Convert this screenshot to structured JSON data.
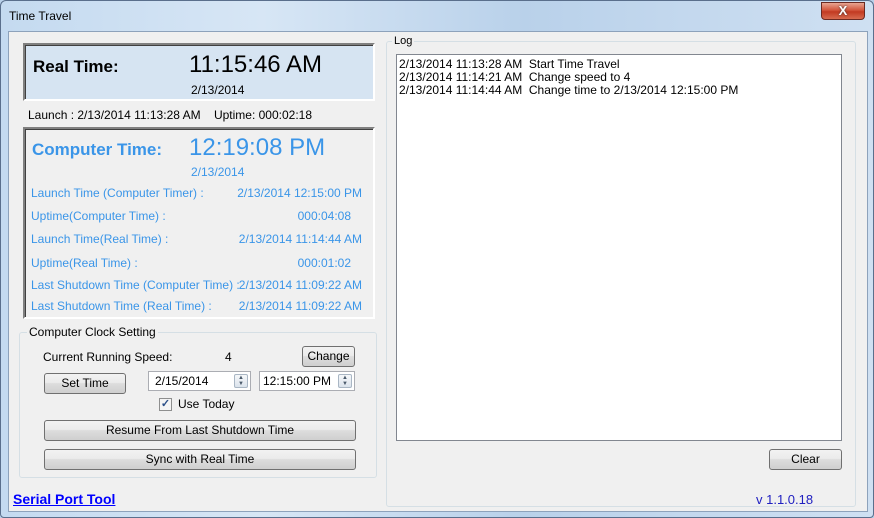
{
  "window": {
    "title": "Time Travel",
    "close_glyph": "X"
  },
  "real_time": {
    "label": "Real Time:",
    "time": "11:15:46 AM",
    "date": "2/13/2014",
    "launch": "Launch : 2/13/2014 11:13:28 AM",
    "uptime": "Uptime: 000:02:18"
  },
  "computer_time": {
    "label": "Computer Time:",
    "time": "12:19:08 PM",
    "date": "2/13/2014",
    "color": "#3a95e8",
    "rows": [
      {
        "key": "Launch Time (Computer Timer) :",
        "value": "2/13/2014 12:15:00 PM"
      },
      {
        "key": "Uptime(Computer Time) :",
        "value": "000:04:08"
      },
      {
        "key": "Launch Time(Real Time) :",
        "value": "2/13/2014 11:14:44 AM"
      },
      {
        "key": "Uptime(Real Time) :",
        "value": "000:01:02"
      },
      {
        "key": "Last Shutdown Time (Computer Time) :",
        "value": "2/13/2014 11:09:22 AM"
      },
      {
        "key": "Last Shutdown Time (Real Time) :",
        "value": "2/13/2014 11:09:22 AM"
      }
    ]
  },
  "clock_setting": {
    "title": "Computer Clock Setting",
    "speed_label": "Current Running Speed:",
    "speed_value": "4",
    "change_label": "Change",
    "set_time_label": "Set Time",
    "date_value": "2/15/2014",
    "time_value": "12:15:00 PM",
    "use_today_label": "Use Today",
    "use_today_checked": true,
    "check_glyph": "✓",
    "spin_glyph": "▲▼",
    "resume_label": "Resume From Last Shutdown Time",
    "sync_label": "Sync with Real Time"
  },
  "log": {
    "title": "Log",
    "entries": [
      "2/13/2014 11:13:28 AM  Start Time Travel",
      "2/13/2014 11:14:21 AM  Change speed to 4",
      "2/13/2014 11:14:44 AM  Change time to 2/13/2014 12:15:00 PM"
    ],
    "clear_label": "Clear"
  },
  "footer": {
    "link_label": "Serial Port Tool",
    "version": "v 1.1.0.18"
  }
}
